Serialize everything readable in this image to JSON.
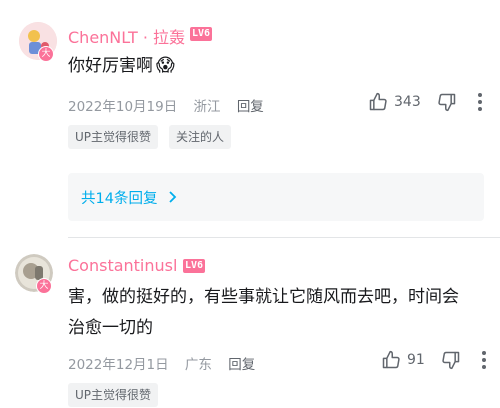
{
  "comments": [
    {
      "user": "ChenNLT · 拉轰",
      "level": "LV6",
      "avatar_badge": "大",
      "text": "你好厉害啊",
      "emoji": "😱",
      "date": "2022年10月19日",
      "location": "浙江",
      "reply_label": "回复",
      "likes": "343",
      "tags": [
        "UP主觉得很赞",
        "关注的人"
      ]
    },
    {
      "user": "Constantinusl",
      "level": "LV6",
      "avatar_badge": "大",
      "text_line1": "害，做的挺好的，有些事就让它随风而去吧，时间会",
      "text_line2": "治愈一切的",
      "date": "2022年12月1日",
      "location": "广东",
      "reply_label": "回复",
      "likes": "91",
      "tags": [
        "UP主觉得很赞"
      ]
    }
  ],
  "replies_link": "共14条回复",
  "colors": {
    "username": "#fb7299",
    "link": "#00aeec",
    "meta": "#9499a0"
  },
  "icons": [
    "thumbs-up-icon",
    "thumbs-down-icon",
    "more-vertical-icon",
    "chevron-right-icon"
  ]
}
